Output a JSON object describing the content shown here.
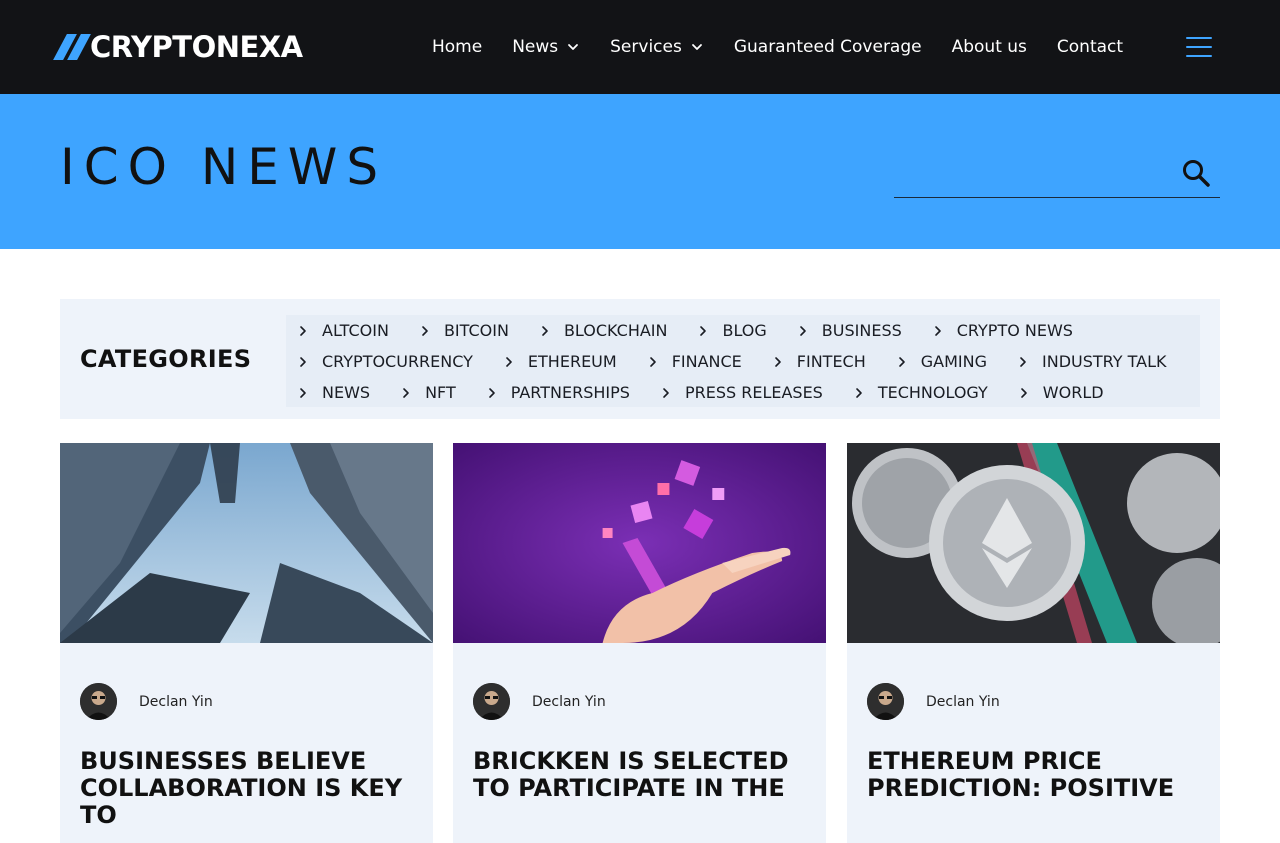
{
  "brand": {
    "name": "CRYPTONEXA",
    "accent": "#3ea4ff"
  },
  "nav": {
    "items": [
      {
        "label": "Home",
        "has_dropdown": false
      },
      {
        "label": "News",
        "has_dropdown": true
      },
      {
        "label": "Services",
        "has_dropdown": true
      },
      {
        "label": "Guaranteed Coverage",
        "has_dropdown": false
      },
      {
        "label": "About us",
        "has_dropdown": false
      },
      {
        "label": "Contact",
        "has_dropdown": false
      }
    ],
    "menu_icon": "hamburger-icon"
  },
  "hero": {
    "title": "ICO NEWS",
    "search": {
      "placeholder": "",
      "icon": "search-icon"
    }
  },
  "categories": {
    "heading": "CATEGORIES",
    "rows": [
      [
        "ALTCOIN",
        "BITCOIN",
        "BLOCKCHAIN",
        "BLOG",
        "BUSINESS",
        "CRYPTO NEWS"
      ],
      [
        "CRYPTOCURRENCY",
        "ETHEREUM",
        "FINANCE",
        "FINTECH",
        "GAMING",
        "INDUSTRY TALK"
      ],
      [
        "NEWS",
        "NFT",
        "PARTNERSHIPS",
        "PRESS RELEASES",
        "TECHNOLOGY",
        "WORLD"
      ]
    ]
  },
  "posts": [
    {
      "author": "Declan Yin",
      "title": "BUSINESSES BELIEVE COLLABORATION IS KEY TO",
      "image": "skyscrapers-looking-up"
    },
    {
      "author": "Declan Yin",
      "title": "BRICKKEN IS SELECTED TO PARTICIPATE IN THE",
      "image": "hand-holding-phone-with-floating-cubes"
    },
    {
      "author": "Declan Yin",
      "title": "ETHEREUM PRICE PREDICTION: POSITIVE",
      "image": "ethereum-coins"
    }
  ]
}
